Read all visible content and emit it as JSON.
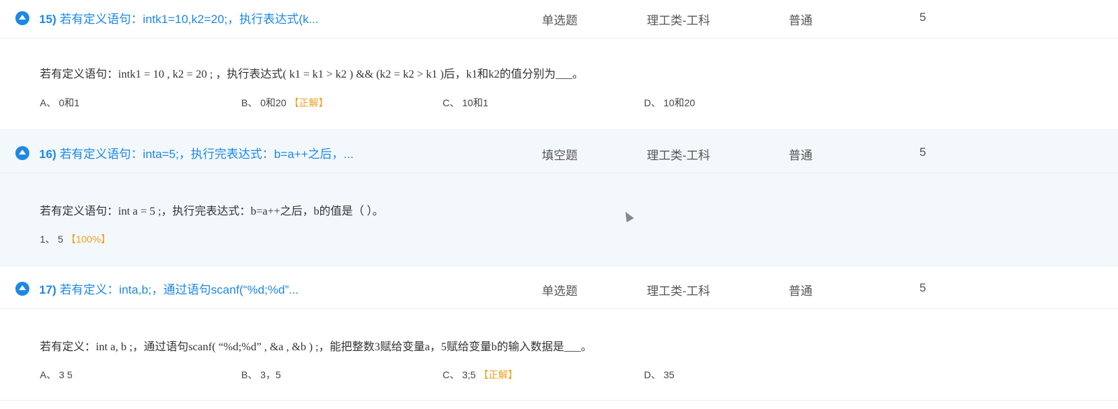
{
  "questions": [
    {
      "number": "15)",
      "title": "若有定义语句：intk1=10,k2=20;，执行表达式(k...",
      "type": "单选题",
      "category": "理工类-工科",
      "difficulty": "普通",
      "score": "5",
      "stem": "若有定义语句：intk1 = 10 , k2 = 20 ; ，执行表达式( k1 = k1 > k2 ) && (k2 = k2 > k1 )后，k1和k2的值分别为___。",
      "options": [
        {
          "text": "A、 0和1",
          "tag": ""
        },
        {
          "text": "B、 0和20",
          "tag": "【正解】"
        },
        {
          "text": "C、 10和1",
          "tag": ""
        },
        {
          "text": "D、 10和20",
          "tag": ""
        }
      ]
    },
    {
      "number": "16)",
      "title": "若有定义语句：inta=5;，执行完表达式：b=a++之后，...",
      "type": "填空题",
      "category": "理工类-工科",
      "difficulty": "普通",
      "score": "5",
      "stem": "若有定义语句：int a = 5 ;，执行完表达式：b=a++之后，b的值是（ ）。",
      "options": [
        {
          "text": "1、 5",
          "tag": "【100%】"
        }
      ]
    },
    {
      "number": "17)",
      "title": "若有定义：inta,b;，通过语句scanf(“%d;%d”...",
      "type": "单选题",
      "category": "理工类-工科",
      "difficulty": "普通",
      "score": "5",
      "stem": "若有定义：int a, b ;，通过语句scanf( “%d;%d” , &a , &b ) ;，能把整数3赋给变量a，5赋给变量b的输入数据是___。",
      "options": [
        {
          "text": "A、 3 5",
          "tag": ""
        },
        {
          "text": "B、 3，5",
          "tag": ""
        },
        {
          "text": "C、 3;5",
          "tag": "【正解】"
        },
        {
          "text": "D、 35",
          "tag": ""
        }
      ]
    }
  ],
  "colors": {
    "accent": "#1e88e5",
    "tag": "#f0a020",
    "highlight": "#f3f8fd"
  }
}
